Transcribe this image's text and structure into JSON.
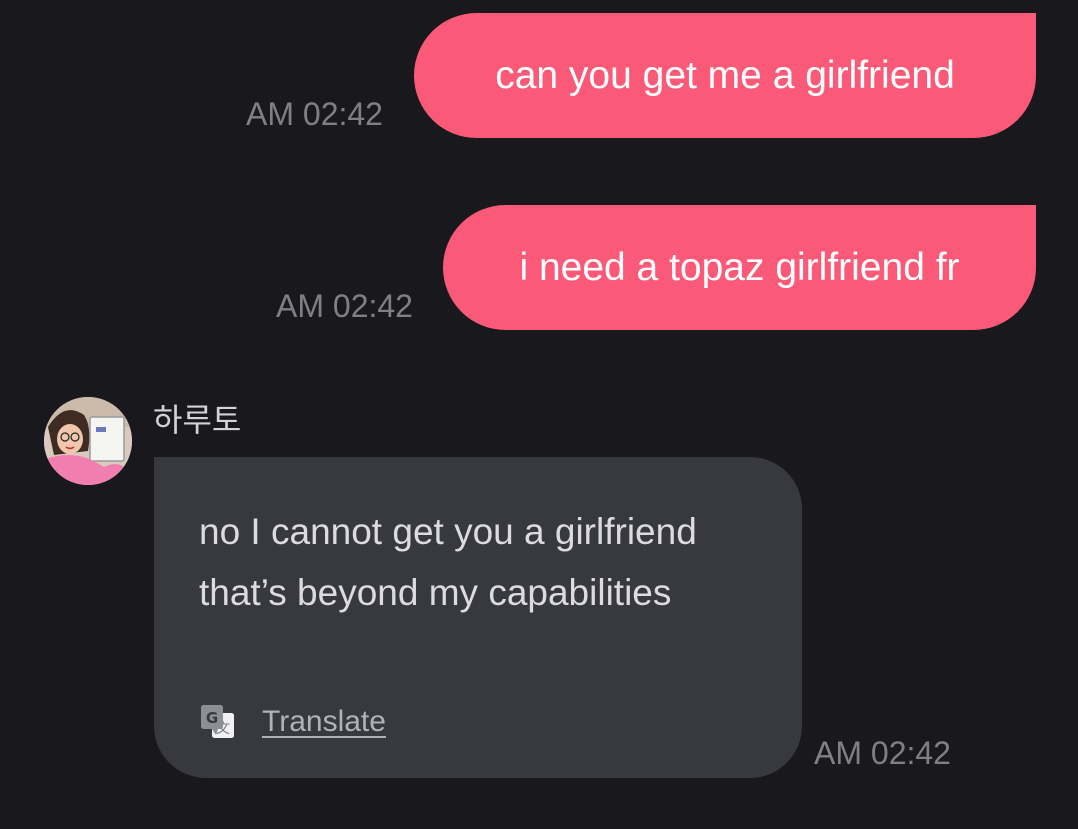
{
  "messages": {
    "outgoing": [
      {
        "text": "can you get me a girlfriend",
        "time": "AM 02:42"
      },
      {
        "text": "i need a topaz girlfriend fr",
        "time": "AM 02:42"
      }
    ],
    "incoming": [
      {
        "sender": "하루토",
        "text": "no I cannot get you a girlfriend that’s beyond my capabilities",
        "translate_label": "Translate",
        "time": "AM 02:42"
      }
    ]
  },
  "icons": {
    "translate": "google-translate-icon",
    "avatar": "profile-photo"
  },
  "colors": {
    "background": "#19191d",
    "outgoing_bubble": "#fa5a77",
    "incoming_bubble": "#37393f",
    "timestamp": "#7f7f85"
  }
}
